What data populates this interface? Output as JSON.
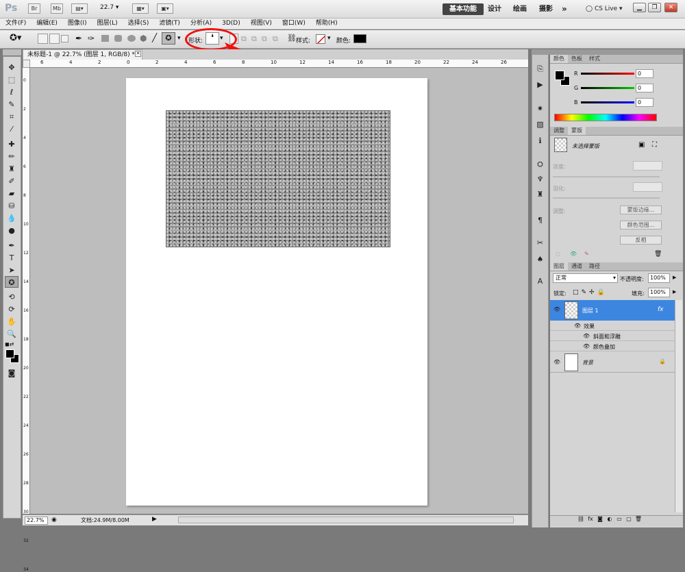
{
  "app": {
    "logo": "Ps",
    "br": "Br",
    "mb": "Mb",
    "zoom": "22.7",
    "workspaces": [
      "基本功能",
      "设计",
      "绘画",
      "摄影"
    ],
    "more": "»",
    "cslive": "CS Live"
  },
  "menu": [
    "文件(F)",
    "编辑(E)",
    "图像(I)",
    "图层(L)",
    "选择(S)",
    "滤镜(T)",
    "分析(A)",
    "3D(D)",
    "视图(V)",
    "窗口(W)",
    "帮助(H)"
  ],
  "options": {
    "shape_label": "形状:",
    "shape_glyph": "❛",
    "style_label": "样式:",
    "color_label": "颜色:",
    "color_value": "#000000"
  },
  "document": {
    "tab_title": "未标题-1 @ 22.7% (图层 1, RGB/8) *",
    "ruler_top": [
      "6",
      "4",
      "2",
      "0",
      "2",
      "4",
      "6",
      "8",
      "10",
      "12",
      "14",
      "16",
      "18",
      "20",
      "22",
      "24",
      "26"
    ],
    "ruler_left": [
      "0",
      "2",
      "4",
      "6",
      "8",
      "10",
      "12",
      "14",
      "16",
      "18",
      "20",
      "22",
      "24",
      "26",
      "28",
      "30",
      "32",
      "34"
    ]
  },
  "status": {
    "zoom": "22.7%",
    "doc": "文档:24.9M/8.00M"
  },
  "color_panel": {
    "tabs": [
      "颜色",
      "色板",
      "样式"
    ],
    "r_label": "R",
    "g_label": "G",
    "b_label": "B",
    "r": "0",
    "g": "0",
    "b": "0"
  },
  "mask_panel": {
    "tabs": [
      "调整",
      "蒙版"
    ],
    "title": "未选择蒙版",
    "density": "浓度:",
    "feather": "羽化:",
    "refine": "调整:",
    "btn_edge": "蒙版边缘...",
    "btn_range": "颜色范围...",
    "btn_invert": "反相"
  },
  "layers_panel": {
    "tabs": [
      "图层",
      "通道",
      "路径"
    ],
    "blend": "正常",
    "opacity_label": "不透明度:",
    "opacity": "100%",
    "lock_label": "锁定:",
    "fill_label": "填充:",
    "fill": "100%",
    "layer1": "图层 1",
    "fx": "fx",
    "effects": "效果",
    "effect1": "斜面和浮雕",
    "effect2": "颜色叠加",
    "background": "背景"
  },
  "colors": {
    "selected_layer": "#3d86e0",
    "annotation": "#ee1111"
  }
}
